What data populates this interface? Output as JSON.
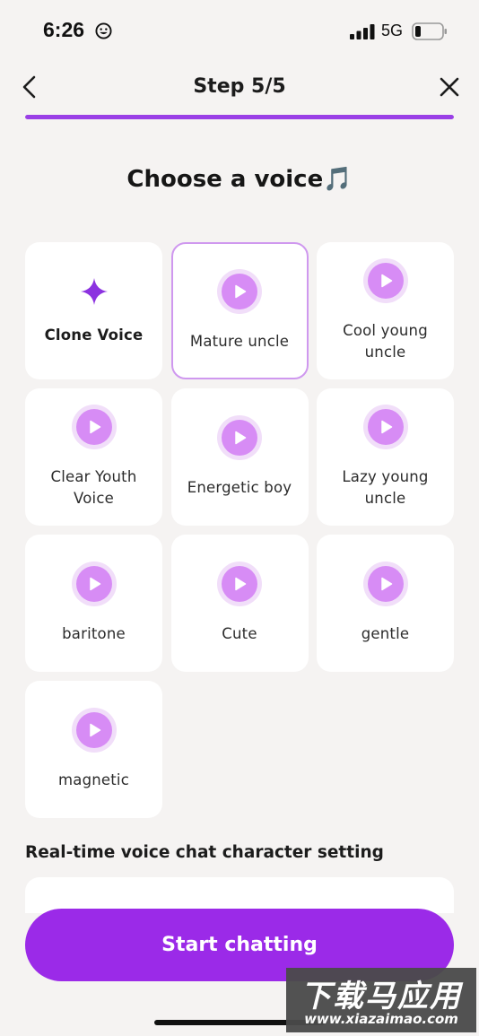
{
  "status_bar": {
    "time": "6:26",
    "network": "5G"
  },
  "header": {
    "step_title": "Step 5/5",
    "progress_fraction": 1.0,
    "accent_color": "#9a3fe6"
  },
  "heading": "Choose a voice🎵",
  "voices": [
    {
      "label": "Clone Voice",
      "icon": "sparkle-icon",
      "selected": false
    },
    {
      "label": "Mature uncle",
      "icon": "play-icon",
      "selected": true
    },
    {
      "label": "Cool young uncle",
      "icon": "play-icon",
      "selected": false
    },
    {
      "label": "Clear Youth Voice",
      "icon": "play-icon",
      "selected": false
    },
    {
      "label": "Energetic boy",
      "icon": "play-icon",
      "selected": false
    },
    {
      "label": "Lazy young uncle",
      "icon": "play-icon",
      "selected": false
    },
    {
      "label": "baritone",
      "icon": "play-icon",
      "selected": false
    },
    {
      "label": "Cute",
      "icon": "play-icon",
      "selected": false
    },
    {
      "label": "gentle",
      "icon": "play-icon",
      "selected": false
    },
    {
      "label": "magnetic",
      "icon": "play-icon",
      "selected": false
    }
  ],
  "section_title": "Real-time voice chat character setting",
  "start_button": "Start chatting",
  "watermark": {
    "title": "下载马应用",
    "url": "www.xiazaimao.com"
  }
}
